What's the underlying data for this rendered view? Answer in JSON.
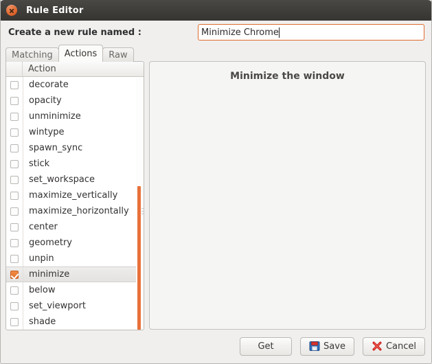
{
  "window": {
    "title": "Rule Editor",
    "close_icon": "close-circle-icon",
    "titlebar_color": "#403e3a",
    "accent_color": "#e06a2b"
  },
  "name_row": {
    "label": "Create a new rule named :",
    "input_value": "Minimize Chrome",
    "input_placeholder": ""
  },
  "tabs": [
    {
      "label": "Matching",
      "active": false
    },
    {
      "label": "Actions",
      "active": true
    },
    {
      "label": "Raw",
      "active": false
    }
  ],
  "list": {
    "header": "Action",
    "rows": [
      {
        "label": "decorate",
        "checked": false,
        "selected": false
      },
      {
        "label": "opacity",
        "checked": false,
        "selected": false
      },
      {
        "label": "unminimize",
        "checked": false,
        "selected": false
      },
      {
        "label": "wintype",
        "checked": false,
        "selected": false
      },
      {
        "label": "spawn_sync",
        "checked": false,
        "selected": false
      },
      {
        "label": "stick",
        "checked": false,
        "selected": false
      },
      {
        "label": "set_workspace",
        "checked": false,
        "selected": false
      },
      {
        "label": "maximize_vertically",
        "checked": false,
        "selected": false
      },
      {
        "label": "maximize_horizontally",
        "checked": false,
        "selected": false
      },
      {
        "label": "center",
        "checked": false,
        "selected": false
      },
      {
        "label": "geometry",
        "checked": false,
        "selected": false
      },
      {
        "label": "unpin",
        "checked": false,
        "selected": false
      },
      {
        "label": "minimize",
        "checked": true,
        "selected": true
      },
      {
        "label": "below",
        "checked": false,
        "selected": false
      },
      {
        "label": "set_viewport",
        "checked": false,
        "selected": false
      },
      {
        "label": "shade",
        "checked": false,
        "selected": false
      }
    ]
  },
  "detail": {
    "title": "Minimize the window"
  },
  "footer": {
    "get_label": "Get",
    "save_label": "Save",
    "cancel_label": "Cancel",
    "save_icon": "floppy-disk-icon",
    "cancel_icon": "red-cross-icon"
  }
}
